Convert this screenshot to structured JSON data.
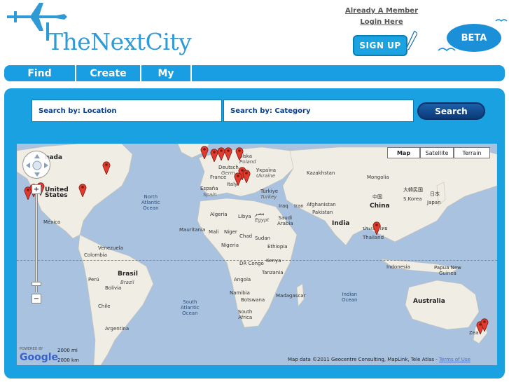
{
  "header": {
    "logo_text": "TheNextCity",
    "member_line1": "Already A Member",
    "member_line2": "Login Here",
    "signup_label": "SIGN UP",
    "beta_label": "BETA"
  },
  "nav": {
    "items": [
      {
        "label": "Find"
      },
      {
        "label": "Create"
      },
      {
        "label": "My"
      }
    ]
  },
  "search": {
    "location_label": "Search by: Location",
    "category_label": "Search by: Category",
    "button_label": "Search"
  },
  "map": {
    "types": [
      "Map",
      "Satellite",
      "Terrain"
    ],
    "selected_type": "Map",
    "labels": {
      "canada": "nada",
      "united_states": "United\nStates",
      "mexico": "México",
      "north_atlantic": "North\nAtlantic\nOcean",
      "venezuela": "Venezuela",
      "colombia": "Colombia",
      "peru": "Perú",
      "brasil": "Brasil",
      "brazil": "Brazil",
      "bolivia": "Bolivia",
      "chile": "Chile",
      "argentina": "Argentina",
      "south_atlantic": "South\nAtlantic\nOcean",
      "espana": "España",
      "spain": "Spain",
      "france": "France",
      "deutschland": "Deutsch",
      "germany": "Germ",
      "italy": "Italy",
      "polska": "olska",
      "poland": "Poland",
      "ukraina": "Україна",
      "ukraine": "Ukraine",
      "turkiye": "Türkiye",
      "turkey": "Turkey",
      "iraq": "Iraq",
      "iran": "Iran",
      "algeria": "Algeria",
      "libya": "Libya",
      "egypt_ar": "مصر",
      "egypt": "Egypt",
      "mauritania": "Mauritania",
      "mali": "Mali",
      "niger": "Niger",
      "chad": "Chad",
      "sudan": "Sudan",
      "nigeria": "Nigeria",
      "ethiopia": "Ethiopia",
      "saudi_arabia": "Saudi\nArabia",
      "afghanistan": "Afghanistan",
      "pakistan": "Pakistan",
      "india": "India",
      "kazakhstan": "Kazakhstan",
      "mongolia": "Mongolia",
      "china_cn": "中国",
      "china": "China",
      "korea_jp": "大韓民国",
      "japan_jp": "日本",
      "korea": "S.Korea",
      "japan": "Japan",
      "thailand_th": "ประเทศไทย",
      "thailand": "Thailand",
      "indonesia": "Indonesia",
      "png": "Papua New\nGuinea",
      "dr_congo": "DR Congo",
      "kenya": "Kenya",
      "tanzania": "Tanzania",
      "angola": "Angola",
      "namibia": "Namibia",
      "botswana": "Botswana",
      "madagascar": "Madagascar",
      "south_africa": "South\nAfrica",
      "indian_ocean": "Indian\nOcean",
      "australia": "Australia",
      "nz": "Zea"
    },
    "scale_top": "2000 mi",
    "scale_bottom": "2000 km",
    "powered_by": "POWERED BY",
    "google": "Google",
    "attribution": "Map data ©2011 Geocentre Consulting, MapLink, Tele Atlas - ",
    "terms": "Terms of Use"
  },
  "colors": {
    "brand_blue": "#1aa1e2",
    "nav_blue": "#1a9ee3",
    "search_button": "#0b3a78",
    "ocean": "#a9c2e0",
    "land": "#f0ede4"
  }
}
